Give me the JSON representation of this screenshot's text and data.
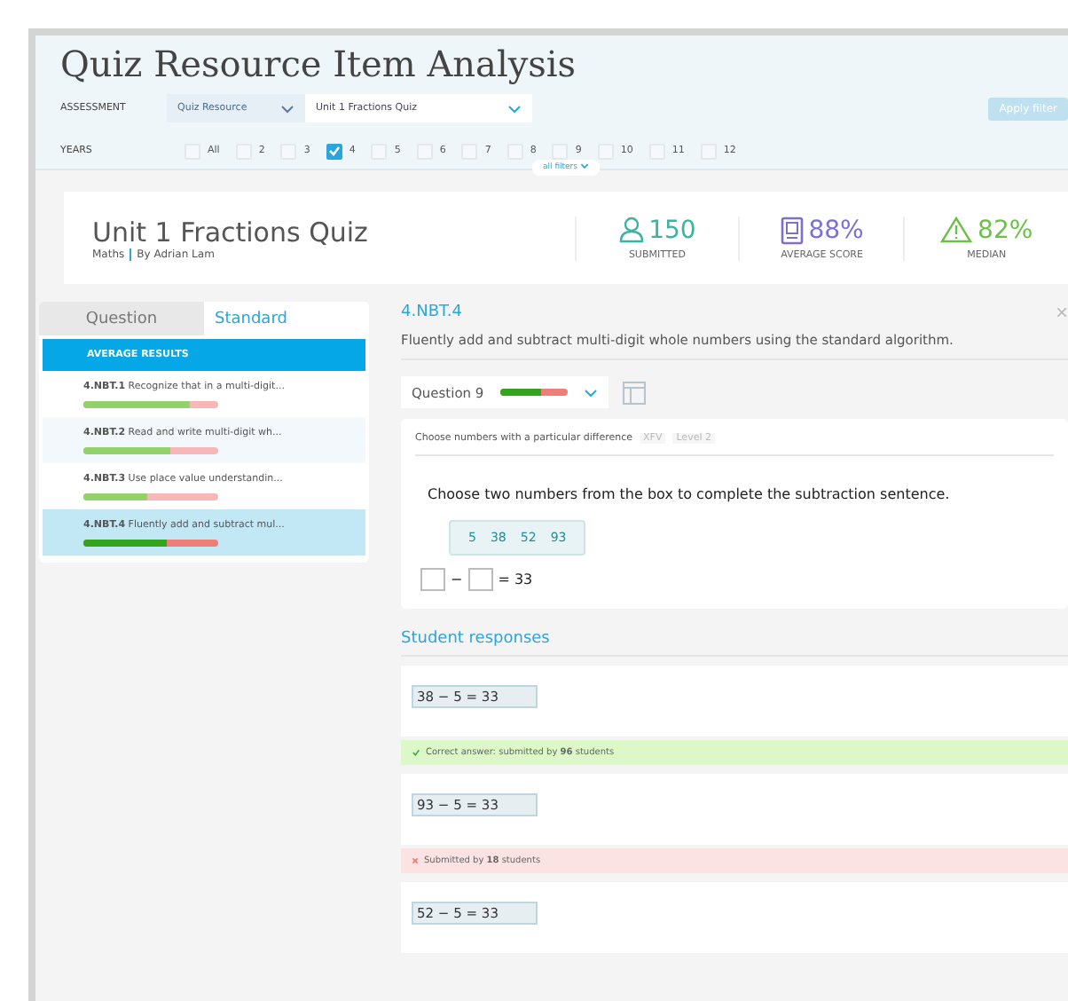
{
  "page": {
    "title": "Quiz Resource Item Analysis"
  },
  "filters": {
    "assessment_label": "ASSESSMENT",
    "resource_type": "Quiz Resource",
    "assessment": "Unit 1 Fractions Quiz",
    "apply_button": "Apply filter",
    "years_label": "YEARS",
    "years": [
      {
        "label": "All",
        "checked": false
      },
      {
        "label": "2",
        "checked": false
      },
      {
        "label": "3",
        "checked": false
      },
      {
        "label": "4",
        "checked": true
      },
      {
        "label": "5",
        "checked": false
      },
      {
        "label": "6",
        "checked": false
      },
      {
        "label": "7",
        "checked": false
      },
      {
        "label": "8",
        "checked": false
      },
      {
        "label": "9",
        "checked": false
      },
      {
        "label": "10",
        "checked": false
      },
      {
        "label": "11",
        "checked": false
      },
      {
        "label": "12",
        "checked": false
      }
    ],
    "all_filters": "all filters"
  },
  "summary": {
    "title": "Unit 1 Fractions Quiz",
    "subject": "Maths",
    "author": "By Adrian Lam",
    "stats": [
      {
        "kind": "people",
        "value": "150",
        "label": "SUBMITTED",
        "color": "#3bb3a0"
      },
      {
        "kind": "score",
        "value": "88%",
        "label": "AVERAGE SCORE",
        "color": "#7b6fd0"
      },
      {
        "kind": "warning",
        "value": "82%",
        "label": "MEDIAN",
        "color": "#6cc04a"
      }
    ]
  },
  "side_panel": {
    "tabs": [
      {
        "label": "Question",
        "selected": false
      },
      {
        "label": "Standard",
        "selected": true
      }
    ],
    "header": "AVERAGE RESULTS",
    "items": [
      {
        "code": "4.NBT.1",
        "text": "Recognize that in a multi-digit...",
        "level": 0.79,
        "selected": false
      },
      {
        "code": "4.NBT.2",
        "text": "Read and write multi-digit wh...",
        "level": 0.64,
        "selected": false
      },
      {
        "code": "4.NBT.3",
        "text": "Use place value understandin...",
        "level": 0.47,
        "selected": false
      },
      {
        "code": "4.NBT.4",
        "text": "Fluently add and subtract mul...",
        "level": 0.62,
        "selected": true
      }
    ]
  },
  "detail": {
    "code": "4.NBT.4",
    "close": "×",
    "description": "Fluently add and subtract multi-digit whole numbers using the standard algorithm.",
    "question_select": {
      "label": "Question 9",
      "level": 0.62
    },
    "question": {
      "title": "Choose numbers with a particular difference",
      "tag_1": "XFV",
      "tag_2": "Level 2",
      "prompt": "Choose two numbers from the box to complete the subtraction sentence.",
      "numbers": [
        "5",
        "38",
        "52",
        "93"
      ],
      "operator": "−",
      "result": "= 33"
    },
    "responses_title": "Student responses",
    "responses": [
      {
        "answer": "38 − 5 = 33",
        "kind": "correct",
        "footer": "Correct answer: submitted by **96** students"
      },
      {
        "answer": "93 − 5 = 33",
        "kind": "incorrect",
        "footer": "Submitted by **18** students"
      },
      {
        "answer": "52 − 5 = 33",
        "kind": "none"
      }
    ]
  }
}
